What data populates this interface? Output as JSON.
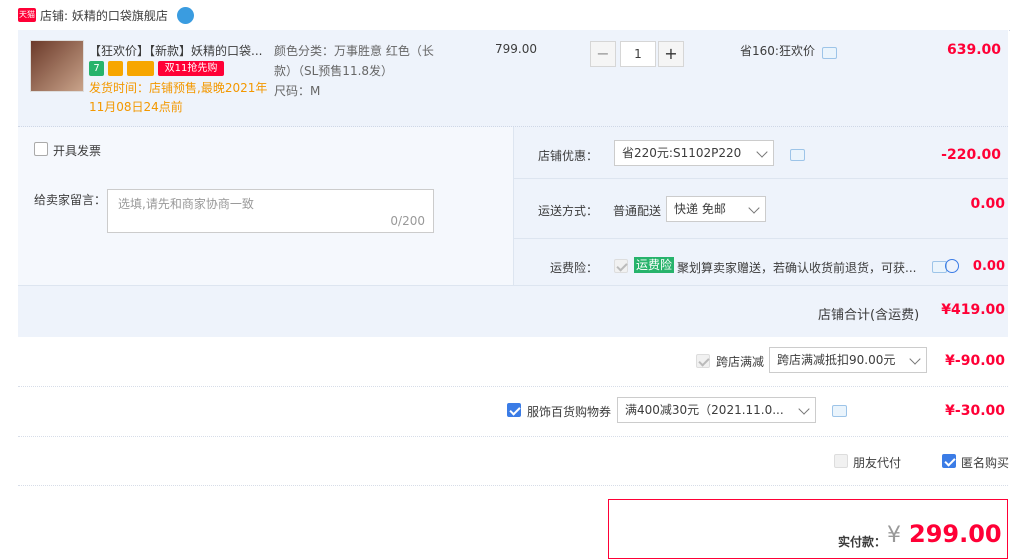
{
  "shop": {
    "badge": "天猫",
    "label": "店铺: 妖精的口袋旗舰店"
  },
  "item": {
    "title": "【狂欢价】【新款】妖精的口袋...",
    "tag_number": "7",
    "promo_tag": "双11抢先购",
    "ship_line1": "发货时间：店铺预售,最晚2021年",
    "ship_line2": "11月08日24点前",
    "attr_color_line1": "颜色分类：万事胜意 红色（长",
    "attr_color_line2": "款）（SL预售11.8发）",
    "attr_size": "尺码：M",
    "unit_price": "799.00",
    "quantity": "1",
    "minus": "−",
    "plus": "+",
    "discount_note": "省160:狂欢价",
    "subtotal": "639.00"
  },
  "invoice": {
    "label": "开具发票"
  },
  "message": {
    "label": "给卖家留言：",
    "placeholder": "选填,请先和商家协商一致",
    "counter": "0/200"
  },
  "shop_discount": {
    "label": "店铺优惠：",
    "value": "省220元:S1102P220",
    "amount": "-220.00"
  },
  "shipping": {
    "label": "运送方式：",
    "type": "普通配送",
    "option": "快递 免邮",
    "amount": "0.00"
  },
  "insurance": {
    "label": "运费险：",
    "badge": "运费险",
    "text": "聚划算卖家赠送，若确认收货前退货，可获...",
    "amount": "0.00"
  },
  "shop_total": {
    "label": "店铺合计(含运费)",
    "amount": "¥419.00"
  },
  "cross_store": {
    "label": "跨店满减",
    "option": "跨店满减抵扣90.00元",
    "amount": "¥-90.00"
  },
  "coupon": {
    "label": "服饰百货购物券",
    "option": "满400减30元（2021.11.0...",
    "amount": "¥-30.00"
  },
  "friend_pay": {
    "label": "朋友代付"
  },
  "anonymous": {
    "label": "匿名购买"
  },
  "payment": {
    "label": "实付款：",
    "currency": "¥",
    "amount": "299.00"
  },
  "colors": {
    "accent": "#ff0036",
    "panel": "#eef3fb",
    "link": "#3b7ce6"
  }
}
